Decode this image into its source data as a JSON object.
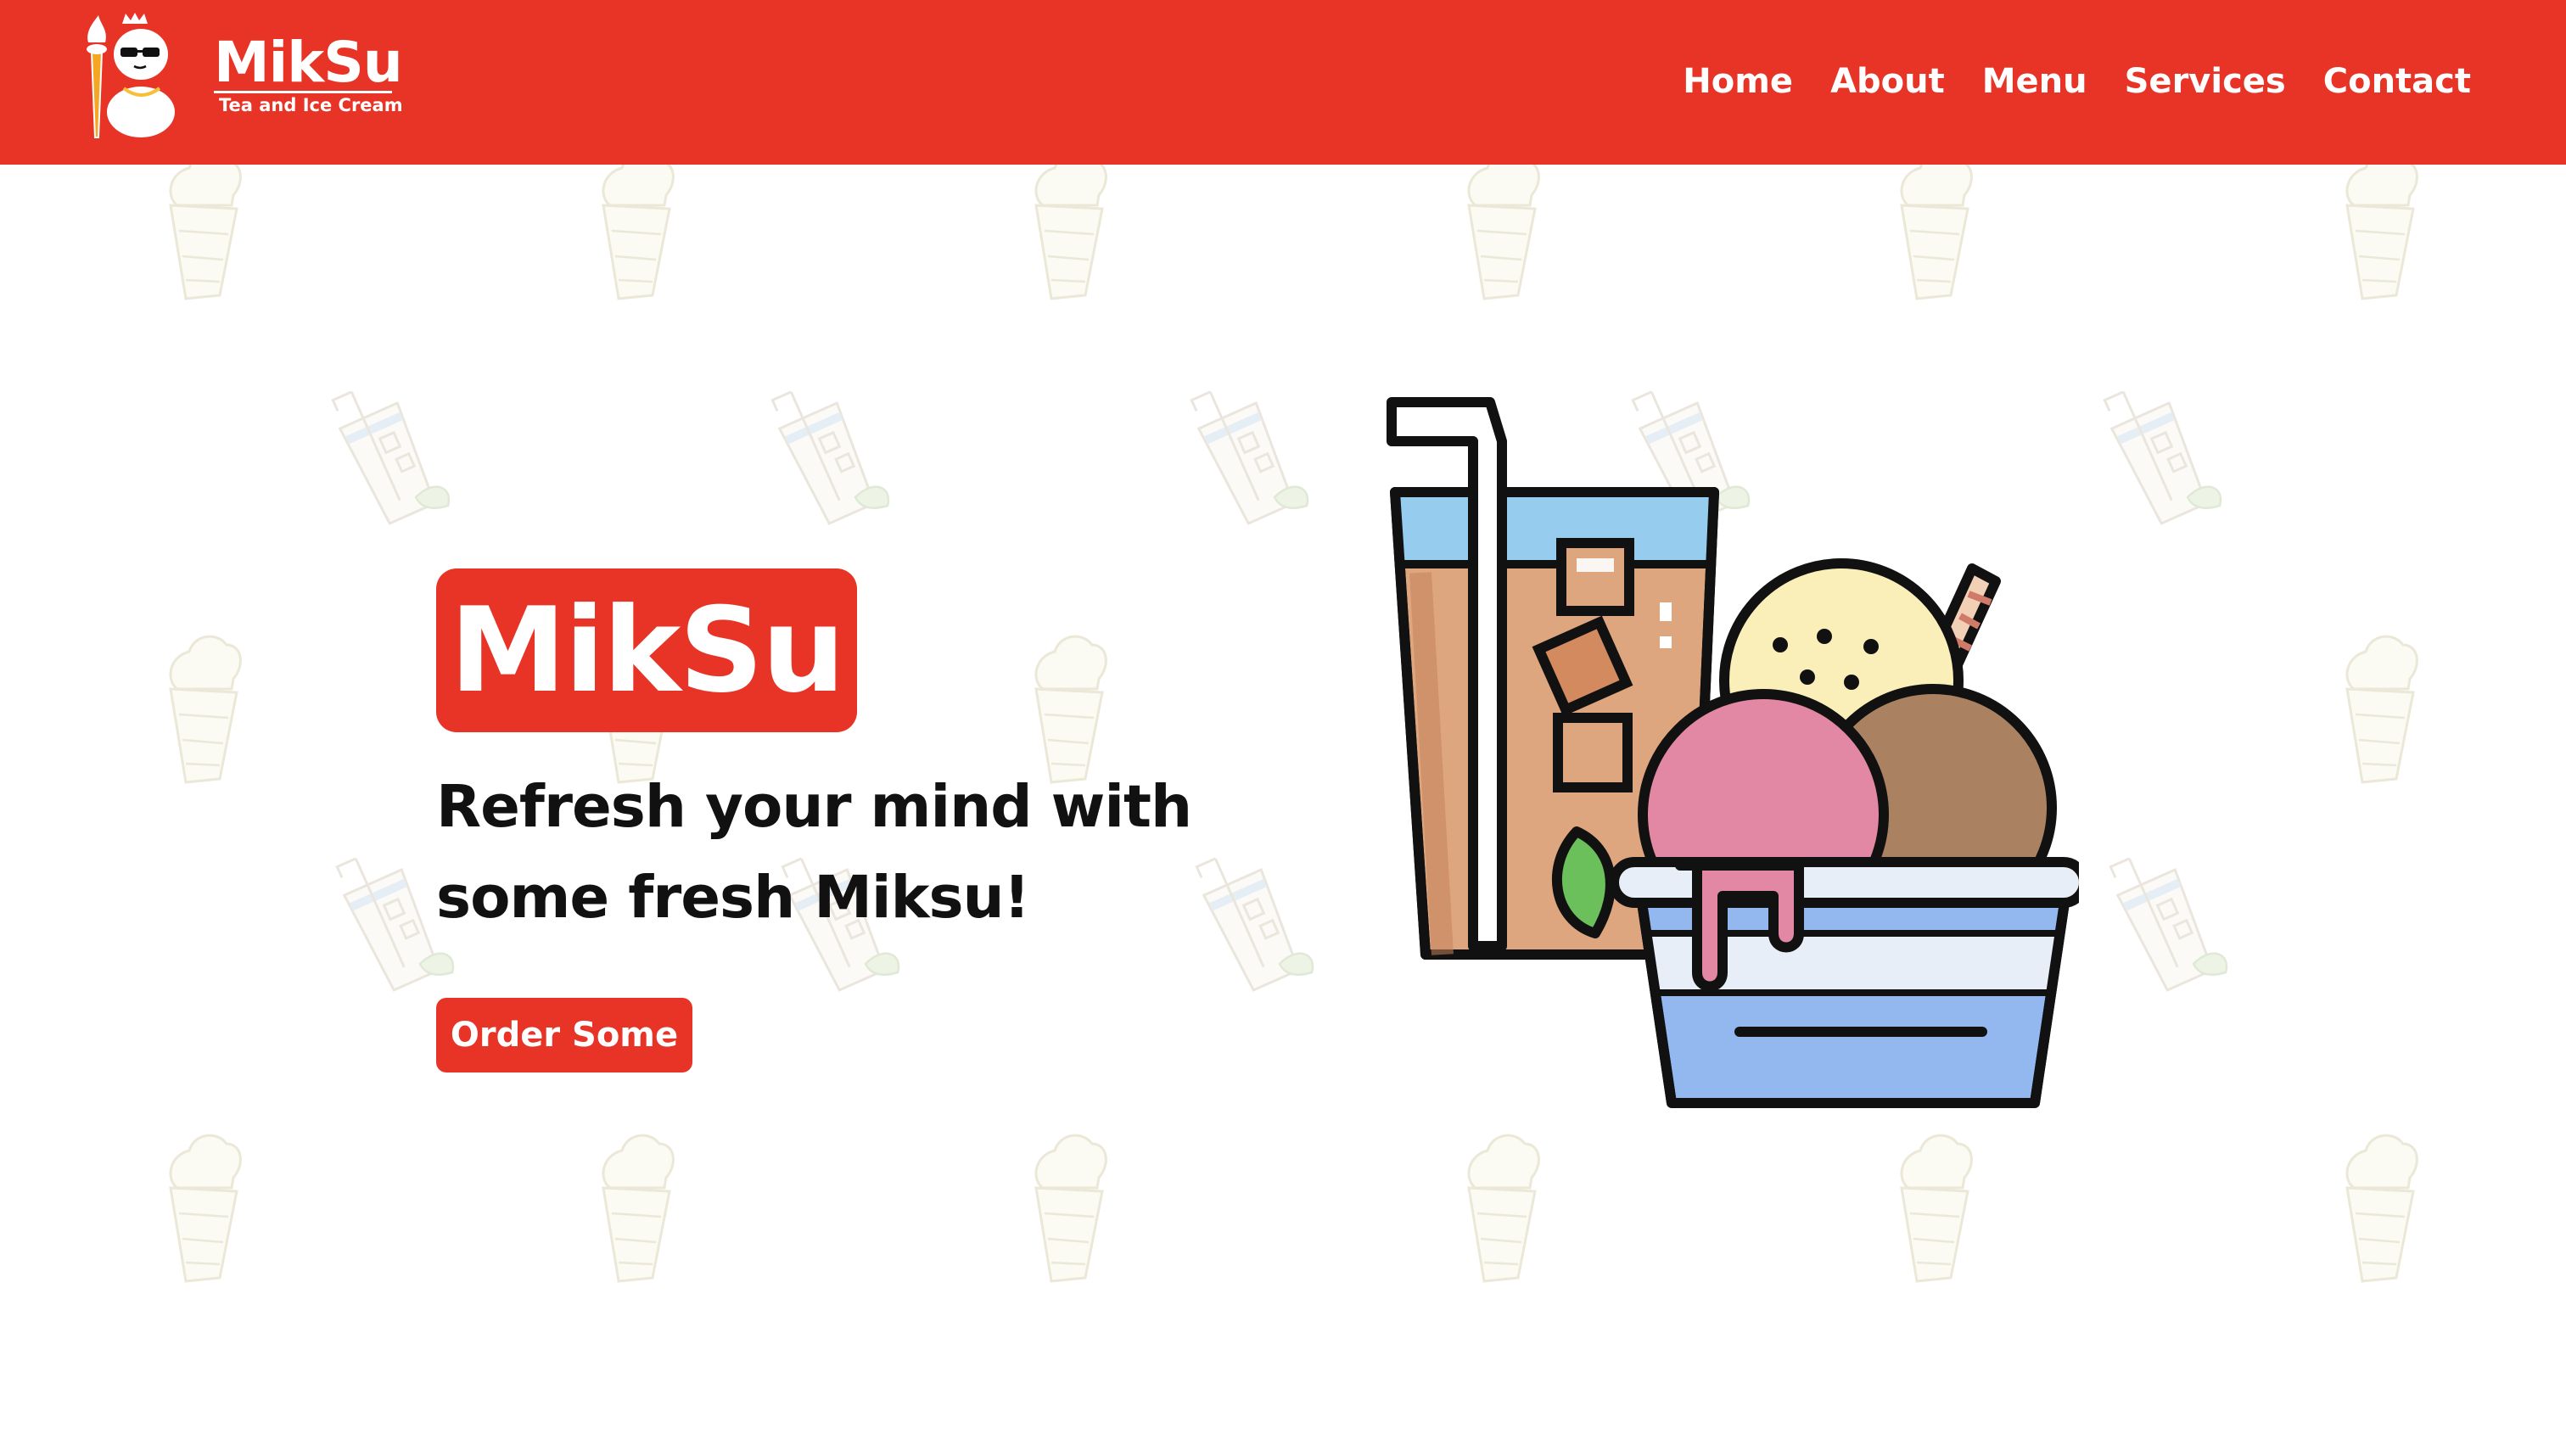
{
  "header": {
    "brand": "MikSu",
    "tagline": "Tea and Ice Cream",
    "nav": [
      {
        "label": "Home"
      },
      {
        "label": "About"
      },
      {
        "label": "Menu"
      },
      {
        "label": "Services"
      },
      {
        "label": "Contact"
      }
    ]
  },
  "hero": {
    "badge": "MikSu",
    "tagline_line1": "Refresh your mind with",
    "tagline_line2": "some fresh Miksu!",
    "cta_label": "Order Some",
    "illustration": "milk-tea-and-ice-cream-illustration"
  },
  "background": {
    "pattern_icons": [
      "ice-cream-cone-icon",
      "iced-tea-glass-icon"
    ]
  },
  "colors": {
    "brand_red": "#e83426",
    "text_dark": "#111111",
    "background": "#ffffff"
  }
}
